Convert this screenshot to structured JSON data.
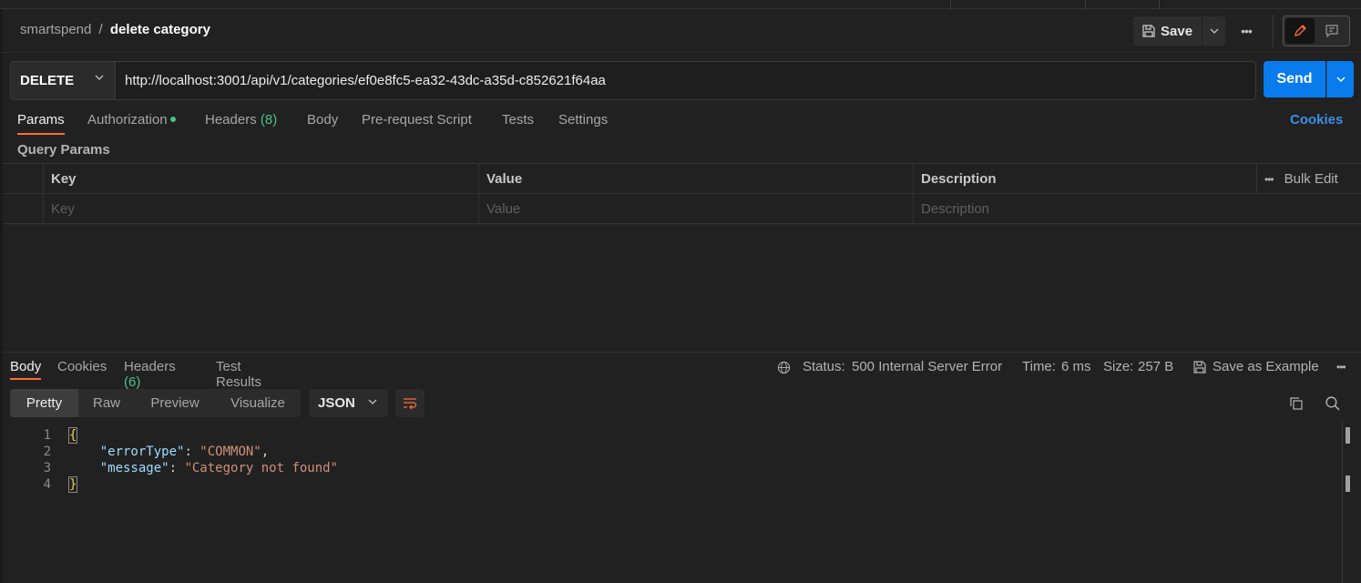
{
  "breadcrumb": {
    "collection": "smartspend",
    "separator": "/",
    "request": "delete category"
  },
  "toolbar": {
    "save_label": "Save"
  },
  "request": {
    "method": "DELETE",
    "url": "http://localhost:3001/api/v1/categories/ef0e8fc5-ea32-43dc-a35d-c852621f64aa",
    "send_label": "Send"
  },
  "request_tabs": {
    "params": "Params",
    "authorization": "Authorization",
    "headers": "Headers",
    "headers_count": "(8)",
    "body": "Body",
    "prerequest": "Pre-request Script",
    "tests": "Tests",
    "settings": "Settings",
    "cookies": "Cookies"
  },
  "query_params": {
    "title": "Query Params",
    "columns": {
      "key": "Key",
      "value": "Value",
      "description": "Description",
      "bulk_edit": "Bulk Edit"
    },
    "placeholders": {
      "key": "Key",
      "value": "Value",
      "description": "Description"
    }
  },
  "response_tabs": {
    "body": "Body",
    "cookies": "Cookies",
    "headers": "Headers",
    "headers_count": "(6)",
    "test_results": "Test Results"
  },
  "response_meta": {
    "status_label": "Status:",
    "status_value": "500 Internal Server Error",
    "time_label": "Time:",
    "time_value": "6 ms",
    "size_label": "Size:",
    "size_value": "257 B",
    "save_example": "Save as Example"
  },
  "format": {
    "pretty": "Pretty",
    "raw": "Raw",
    "preview": "Preview",
    "visualize": "Visualize",
    "language": "JSON"
  },
  "response_body": {
    "line_numbers": [
      "1",
      "2",
      "3",
      "4"
    ],
    "open_brace": "{",
    "close_brace": "}",
    "lines": [
      {
        "key": "\"errorType\"",
        "value": "\"COMMON\"",
        "trailing": ","
      },
      {
        "key": "\"message\"",
        "value": "\"Category not found\"",
        "trailing": ""
      }
    ]
  },
  "colors": {
    "accent": "#ff6c37",
    "send": "#097bed",
    "success_green": "#49c28a",
    "link_blue": "#3b8fe8"
  }
}
